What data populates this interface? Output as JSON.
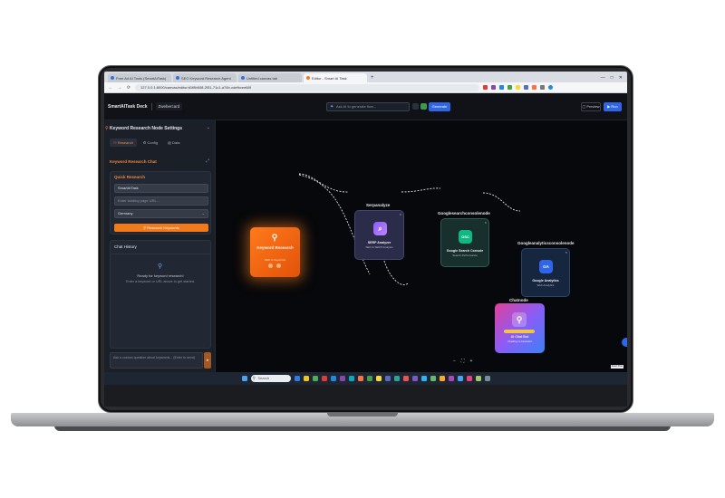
{
  "browser": {
    "tabs": [
      {
        "label": "Free Ad AI Tools (SmartAiTask)",
        "active": false
      },
      {
        "label": "SEO Keyword Research Agent",
        "active": false
      },
      {
        "label": "Untitled canvas tab",
        "active": false
      },
      {
        "label": "Editor - Smart AI Task",
        "active": true
      }
    ],
    "new_tab": "+",
    "url": "127.0.0.1:8000/canvas/editor/d1f8b608-2f31-71c1-a74b-cdefbcee68f",
    "nav": {
      "back": "←",
      "forward": "→",
      "reload": "⟳"
    },
    "window_controls": {
      "minimize": "—",
      "maximize": "□",
      "close": "✕"
    }
  },
  "header": {
    "brand": "SmartAITask Deck",
    "workspace": "Zwebercard",
    "ai_placeholder": "Ask AI to generate flow...",
    "generate_label": "Generate",
    "preview_label": "▢ Preview",
    "run_label": "▶ Run"
  },
  "panel": {
    "title": "Keyword Research Node Settings",
    "tabs": [
      {
        "label": "⚇ Research",
        "active": true
      },
      {
        "label": "⚙ Config",
        "active": false
      },
      {
        "label": "▤ Data",
        "active": false
      }
    ],
    "chat_header": "Keyword Research Chat",
    "quick_research": {
      "title": "Quick Research",
      "keyword_value": "SmartAITask",
      "url_placeholder": "Enter landing page URL...",
      "country": "Germany",
      "button_label": "⚲ Research Keywords"
    },
    "chat_history": {
      "title": "Chat History",
      "ready": "Ready for keyword research!",
      "hint": "Enter a keyword or URL above to get started."
    },
    "chat_input_placeholder": "Ask a custom question about keywords... (Enter to send)",
    "send_label": "➤"
  },
  "canvas": {
    "nodes": [
      {
        "id": "keyword",
        "label": "",
        "name": "Keyword Research",
        "sub": "SEO & Keywords",
        "icon": "⚲"
      },
      {
        "id": "serp",
        "label": "Serpanalyze",
        "name": "SERP Analyzer",
        "sub": "SEO & SERP Analysis",
        "icon": "⌕"
      },
      {
        "id": "gsc",
        "label": "Googlesearchconsolenode",
        "name": "Google Search Console",
        "sub": "Search Performance",
        "icon": "GSC"
      },
      {
        "id": "ga",
        "label": "Googleanalyticsconsolenode",
        "name": "Google Analytics",
        "sub": "Web Analytics",
        "icon": "GA"
      },
      {
        "id": "chat",
        "label": "Chatnode",
        "name": "AI Chat Bot",
        "sub": "Chatting & Assistant",
        "icon": "⚲"
      }
    ],
    "zoom_controls": {
      "zoom_out": "−",
      "fit": "⛶",
      "zoom_in": "+"
    },
    "minimap_tag": "React Flow"
  },
  "taskbar": {
    "search_placeholder": "Search",
    "app_colors": [
      "#2d7be5",
      "#f0c419",
      "#4caf50",
      "#e53935",
      "#1e88e5",
      "#8e44ad",
      "#00acc1",
      "#ff7043",
      "#43a047",
      "#fdd835",
      "#5c6bc0",
      "#26a69a",
      "#ef5350",
      "#7e57c2",
      "#29b6f6",
      "#66bb6a",
      "#ffa726",
      "#ab47bc",
      "#42a5f5",
      "#ec407a",
      "#9ccc65",
      "#78909c"
    ]
  },
  "colors": {
    "accent": "#f27a1a",
    "primary": "#2f66e8",
    "canvas_bg": "#07080b"
  }
}
